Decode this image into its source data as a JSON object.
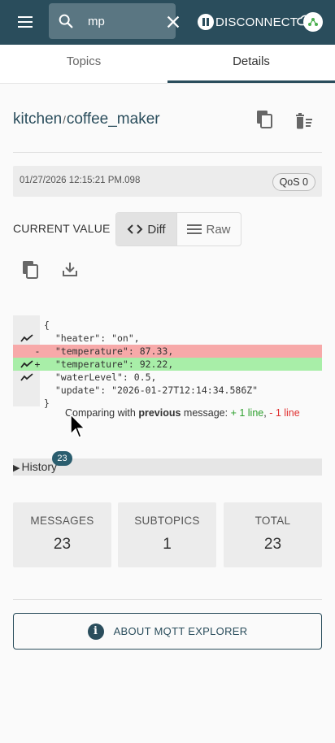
{
  "search": {
    "value": "mp",
    "placeholder": ""
  },
  "connection": {
    "disconnect_label": "DISCONNECT"
  },
  "tabs": [
    {
      "label": "Topics"
    },
    {
      "label": "Details"
    }
  ],
  "topic": {
    "parent": "kitchen",
    "separator": "/",
    "name": "coffee_maker"
  },
  "message": {
    "timestamp": "01/27/2026 12:15:21 PM.098",
    "qos": "QoS 0"
  },
  "value_view": {
    "label": "CURRENT VALUE",
    "diff_label": "Diff",
    "raw_label": "Raw"
  },
  "diff": {
    "lines": [
      {
        "type": "context",
        "mark": "",
        "icon": false,
        "text": "{"
      },
      {
        "type": "context",
        "mark": "",
        "icon": true,
        "text": "  \"heater\": \"on\","
      },
      {
        "type": "removed",
        "mark": "-",
        "icon": false,
        "text": "  \"temperature\": 87.33,"
      },
      {
        "type": "added",
        "mark": "+",
        "icon": true,
        "text": "  \"temperature\": 92.22,"
      },
      {
        "type": "context",
        "mark": "",
        "icon": true,
        "text": "  \"waterLevel\": 0.5,"
      },
      {
        "type": "context",
        "mark": "",
        "icon": false,
        "text": "  \"update\": \"2026-01-27T12:14:34.586Z\""
      },
      {
        "type": "context",
        "mark": "",
        "icon": false,
        "text": "}"
      }
    ],
    "compare_prefix": "Comparing with ",
    "compare_ref": "previous",
    "compare_mid": " message: ",
    "added_summary": "+ 1 line",
    "separator": ", ",
    "removed_summary": "- 1 line"
  },
  "history": {
    "label": "History",
    "arrow": "▶",
    "count": "23"
  },
  "stats": [
    {
      "label": "MESSAGES",
      "value": "23"
    },
    {
      "label": "SUBTOPICS",
      "value": "1"
    },
    {
      "label": "TOTAL",
      "value": "23"
    }
  ],
  "about": {
    "label": "ABOUT MQTT EXPLORER"
  },
  "colors": {
    "appbar": "#2a4d5c",
    "added": "#a8eea8",
    "removed": "#f7a9a9",
    "accent": "#2a4d5c"
  }
}
